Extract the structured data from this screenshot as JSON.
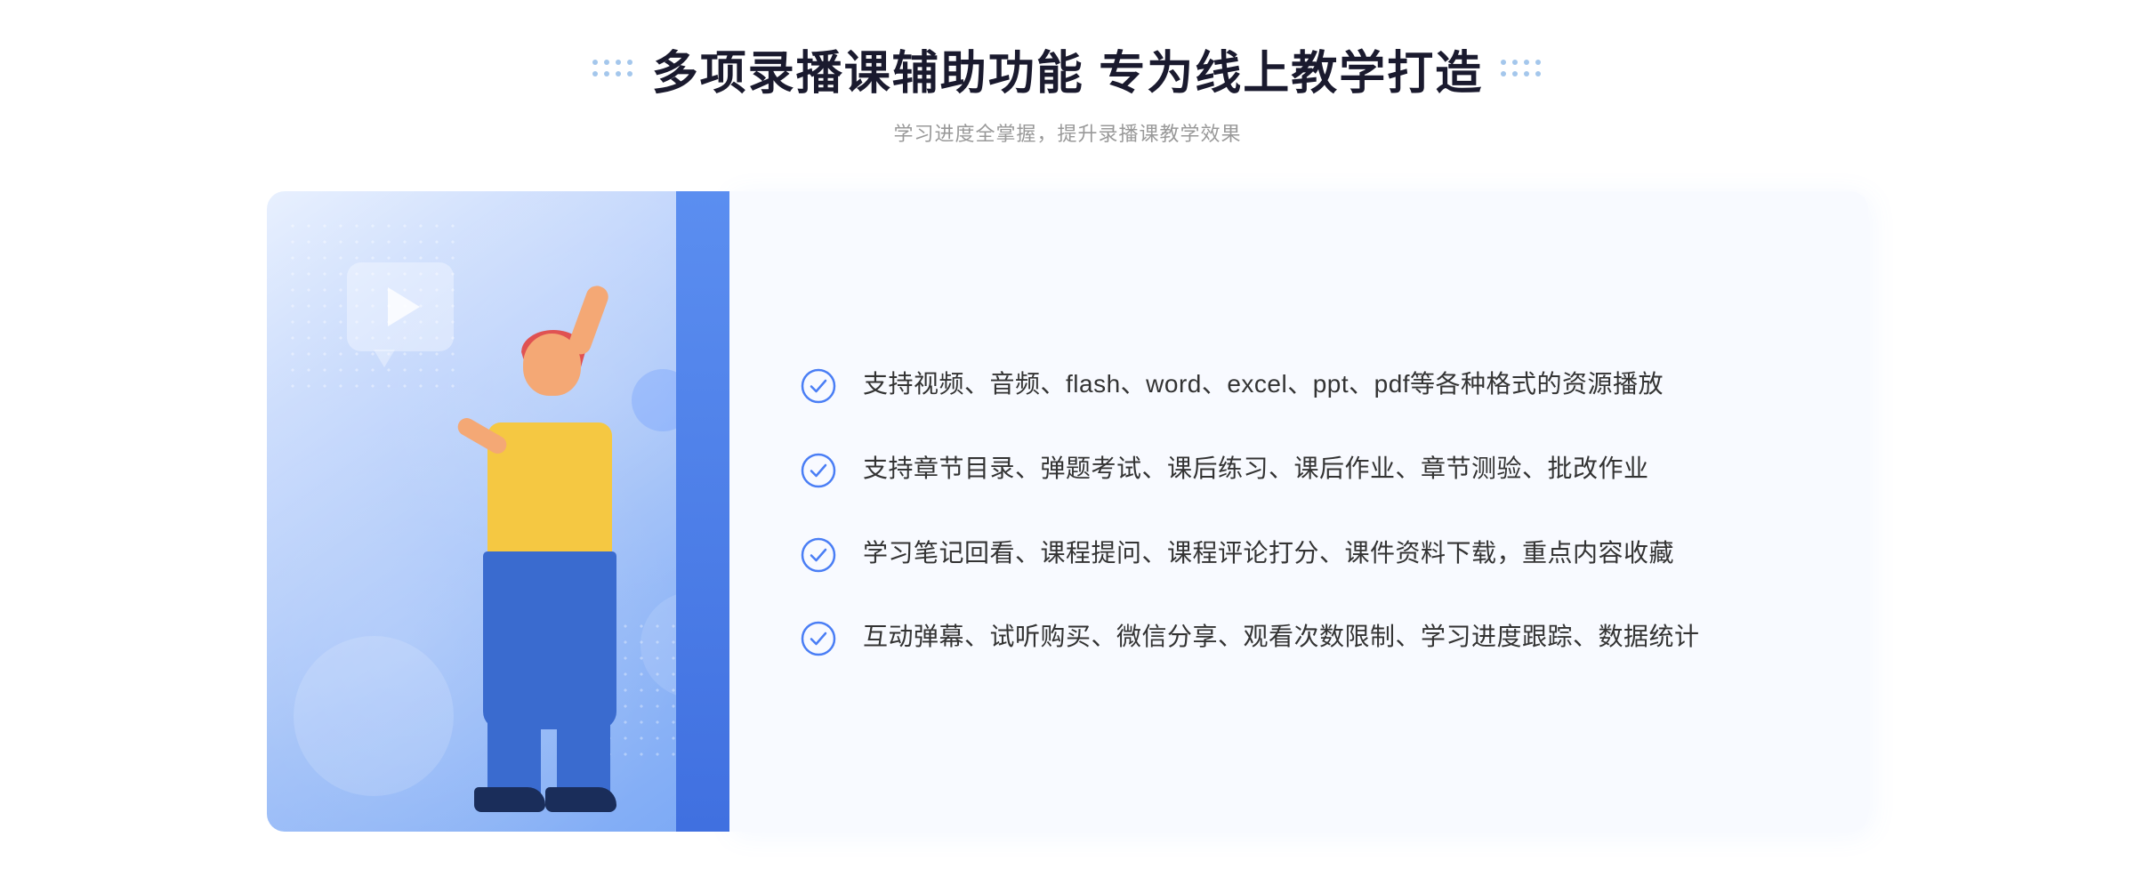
{
  "header": {
    "title": "多项录播课辅助功能 专为线上教学打造",
    "subtitle": "学习进度全掌握，提升录播课教学效果",
    "dots_left": "∷",
    "dots_right": "∷"
  },
  "features": [
    {
      "id": 1,
      "text": "支持视频、音频、flash、word、excel、ppt、pdf等各种格式的资源播放"
    },
    {
      "id": 2,
      "text": "支持章节目录、弹题考试、课后练习、课后作业、章节测验、批改作业"
    },
    {
      "id": 3,
      "text": "学习笔记回看、课程提问、课程评论打分、课件资料下载，重点内容收藏"
    },
    {
      "id": 4,
      "text": "互动弹幕、试听购买、微信分享、观看次数限制、学习进度跟踪、数据统计"
    }
  ],
  "illustration": {
    "alt": "教学插图"
  },
  "colors": {
    "primary_blue": "#4a7ef5",
    "light_blue": "#e8f0fe",
    "text_dark": "#1a1a2e",
    "text_gray": "#999999",
    "check_color": "#4a7ef5"
  }
}
